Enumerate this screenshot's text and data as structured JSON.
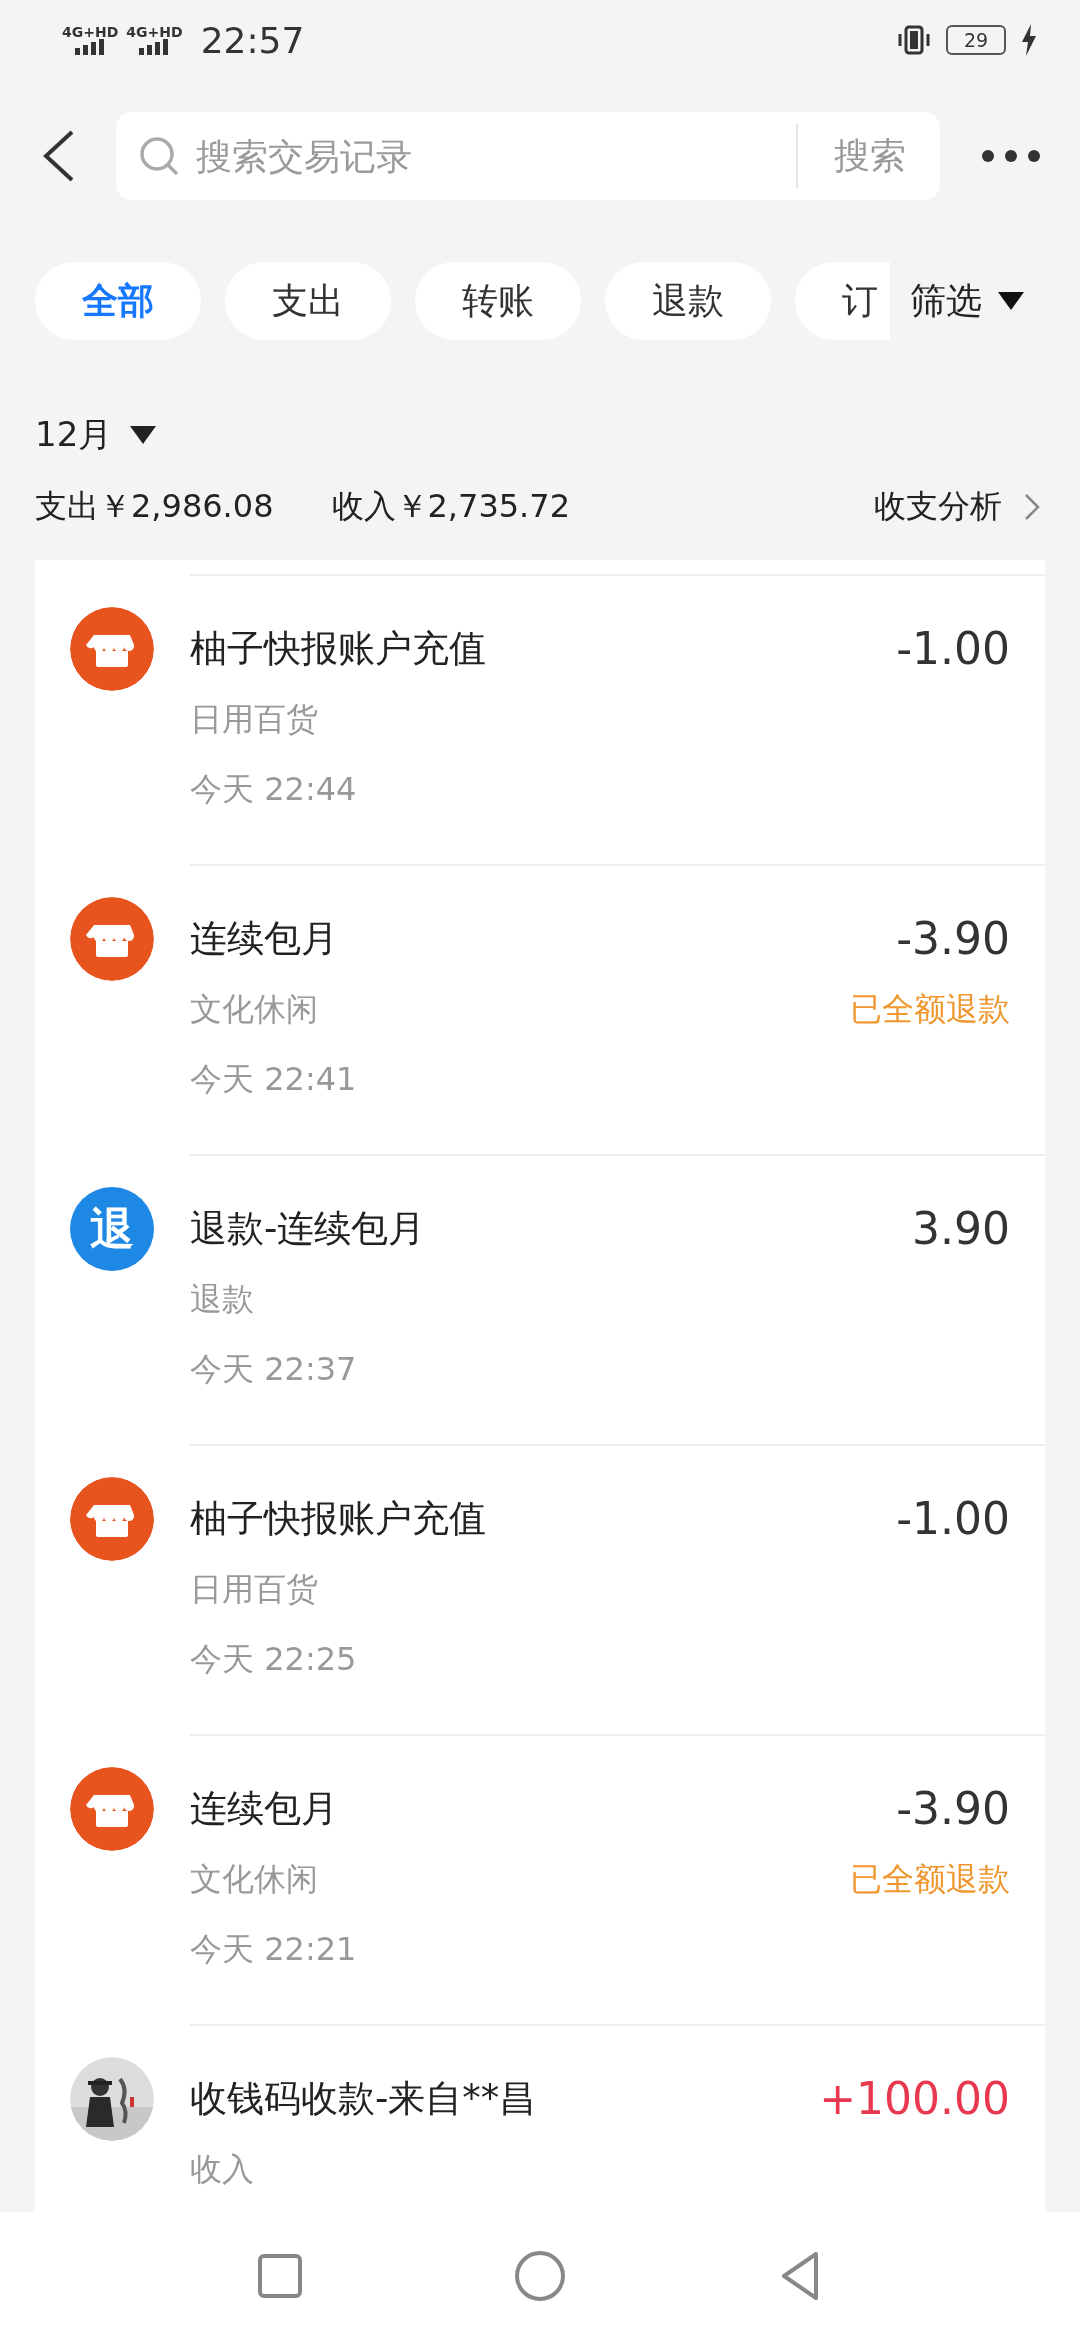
{
  "status_bar": {
    "signal_labels": [
      "4G+HD",
      "4G+HD"
    ],
    "time": "22:57",
    "battery": "29"
  },
  "header": {
    "search": {
      "placeholder": "搜索交易记录",
      "button": "搜索"
    }
  },
  "filter_chips": [
    {
      "label": "全部",
      "selected": true
    },
    {
      "label": "支出",
      "selected": false
    },
    {
      "label": "转账",
      "selected": false
    },
    {
      "label": "退款",
      "selected": false
    },
    {
      "label": "订",
      "selected": false
    }
  ],
  "filter_button": "筛选",
  "month": "12月",
  "summary": {
    "expense": "支出￥2,986.08",
    "income": "收入￥2,735.72",
    "analysis_link": "收支分析"
  },
  "transactions": [
    {
      "kind": "shop",
      "title": "柚子快报账户充值",
      "category": "日用百货",
      "time": "今天 22:44",
      "amount": "-1.00",
      "emphasized": false
    },
    {
      "kind": "shop",
      "title": "连续包月",
      "category": "文化休闲",
      "time": "今天 22:41",
      "amount": "-3.90",
      "status": "已全额退款",
      "emphasized": false
    },
    {
      "kind": "refund",
      "icon_text": "退",
      "title": "退款-连续包月",
      "category": "退款",
      "time": "今天 22:37",
      "amount": "3.90",
      "emphasized": false
    },
    {
      "kind": "shop",
      "title": "柚子快报账户充值",
      "category": "日用百货",
      "time": "今天 22:25",
      "amount": "-1.00",
      "emphasized": false
    },
    {
      "kind": "shop",
      "title": "连续包月",
      "category": "文化休闲",
      "time": "今天 22:21",
      "amount": "-3.90",
      "status": "已全额退款",
      "emphasized": false
    },
    {
      "kind": "avatar",
      "title": "收钱码收款-来自**昌",
      "category": "收入",
      "amount": "+100.00",
      "emphasized": true
    }
  ]
}
